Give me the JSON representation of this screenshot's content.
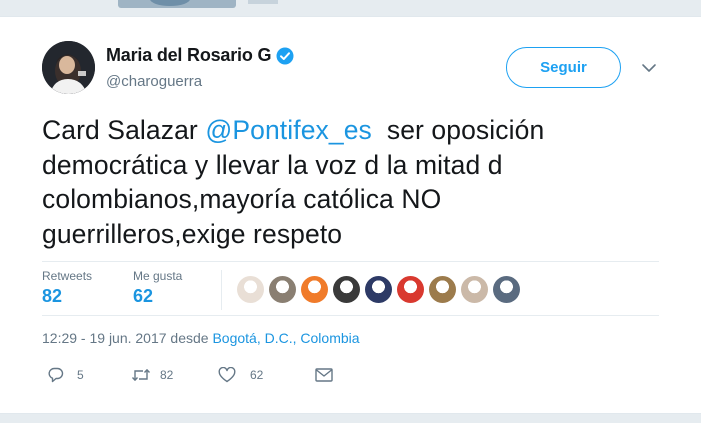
{
  "tweet": {
    "author_name": "Maria del Rosario G",
    "author_handle": "@charoguerra",
    "follow_label": "Seguir",
    "text_lines": [
      {
        "before": "Card Salazar ",
        "mention": "@Pontifex_es",
        "after": "  ser oposición"
      },
      {
        "text": "democrática y llevar la voz d la mitad d"
      },
      {
        "text": "colombianos,mayoría católica NO"
      },
      {
        "text": "guerrilleros,exige respeto"
      }
    ],
    "stats": {
      "retweets_label": "Retweets",
      "retweets_value": "82",
      "likes_label": "Me gusta",
      "likes_value": "62"
    },
    "timestamp": "12:29 - 19 jun. 2017 desde ",
    "location": "Bogotá, D.C., Colombia",
    "actions": {
      "reply_count": "5",
      "retweet_count": "82",
      "like_count": "62"
    }
  },
  "colors": {
    "accent": "#1da1f2",
    "link": "#1b95e0",
    "muted": "#657786",
    "text": "#14171a",
    "background": "#e6ecf0"
  },
  "icons": [
    "verified-badge-icon",
    "chevron-down-icon",
    "reply-icon",
    "retweet-icon",
    "heart-icon",
    "envelope-icon"
  ],
  "liker_avatar_colors": [
    "#e9dfd6",
    "#8a7f72",
    "#f07b2a",
    "#3a3a3a",
    "#2d3a66",
    "#d9392f",
    "#9c7b4c",
    "#cbb9a8",
    "#5a6b80"
  ]
}
